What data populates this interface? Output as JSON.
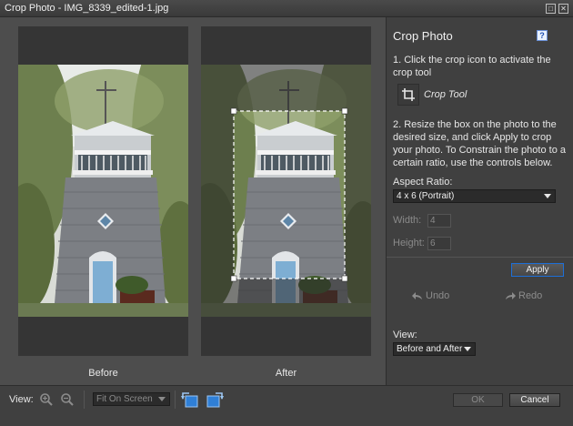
{
  "window": {
    "title": "Crop Photo - IMG_8339_edited-1.jpg"
  },
  "panes": {
    "before_label": "Before",
    "after_label": "After"
  },
  "panel": {
    "title": "Crop Photo",
    "help_icon": "?",
    "step1": "1. Click the crop icon to activate the crop tool",
    "crop_tool_label": "Crop Tool",
    "step2": "2. Resize the box on the photo to the desired size, and click Apply to crop your photo. To Constrain the photo to a certain ratio, use the controls below.",
    "aspect_ratio_label": "Aspect Ratio:",
    "aspect_ratio_value": "4 x 6 (Portrait)",
    "width_label": "Width:",
    "width_value": "4",
    "height_label": "Height:",
    "height_value": "6",
    "apply_label": "Apply",
    "undo_label": "Undo",
    "redo_label": "Redo",
    "view_label": "View:",
    "view_value": "Before and After"
  },
  "bottom": {
    "view_label": "View:",
    "zoom_mode": "Fit On Screen",
    "ok_label": "OK",
    "cancel_label": "Cancel"
  },
  "icons": {
    "zoom_in": "zoom-in-icon",
    "zoom_out": "zoom-out-icon",
    "rotate_left": "rotate-left-icon",
    "rotate_right": "rotate-right-icon",
    "crop": "crop-icon",
    "help": "help-icon"
  },
  "colors": {
    "accent": "#1d6fd8",
    "panel_bg": "#404040",
    "workspace_bg": "#4d4d4d"
  }
}
